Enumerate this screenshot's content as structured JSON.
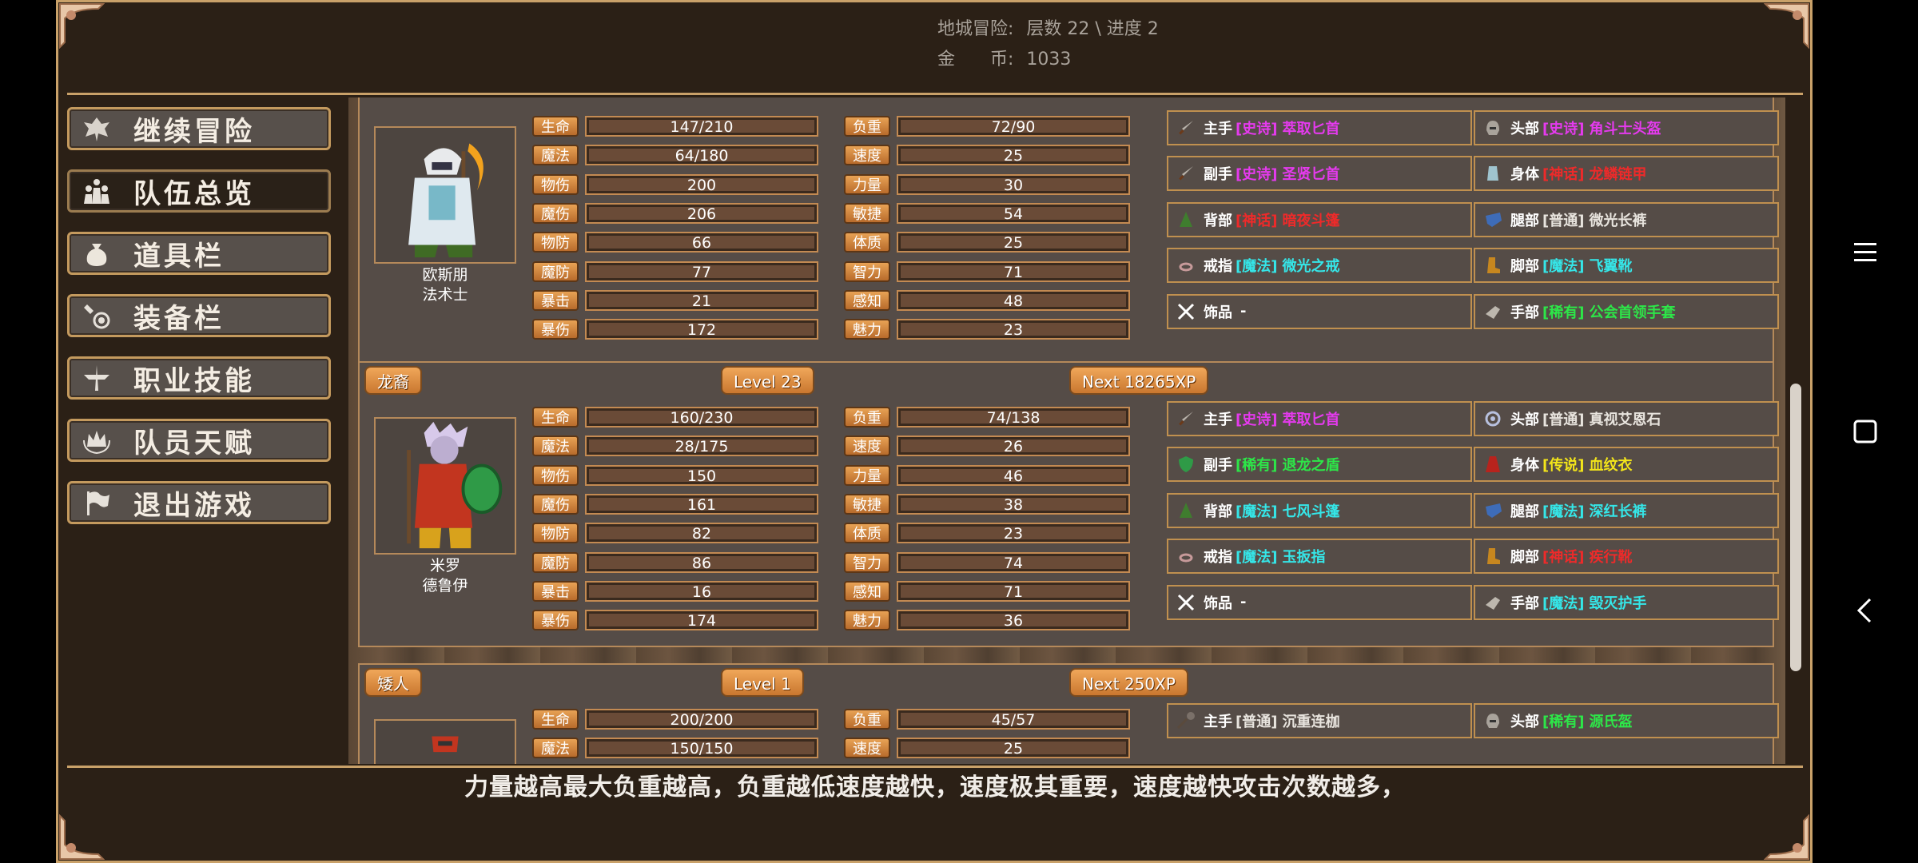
{
  "header": {
    "dungeon_label": "地城冒险:",
    "dungeon_value": "层数 22 \\ 进度 2",
    "gold_label": "金　　币:",
    "gold_value": "1033"
  },
  "menu": [
    {
      "label": "继续冒险",
      "icon": "dragon-icon",
      "active": false
    },
    {
      "label": "队伍总览",
      "icon": "party-icon",
      "active": true
    },
    {
      "label": "道具栏",
      "icon": "bag-icon",
      "active": false
    },
    {
      "label": "装备栏",
      "icon": "equipment-icon",
      "active": false
    },
    {
      "label": "职业技能",
      "icon": "skill-icon",
      "active": false
    },
    {
      "label": "队员天赋",
      "icon": "talent-icon",
      "active": false
    },
    {
      "label": "退出游戏",
      "icon": "flag-icon",
      "active": false
    }
  ],
  "stat_labels_left": [
    "生命",
    "魔法",
    "物伤",
    "魔伤",
    "物防",
    "魔防",
    "暴击",
    "暴伤"
  ],
  "stat_labels_right": [
    "负重",
    "速度",
    "力量",
    "敏捷",
    "体质",
    "智力",
    "感知",
    "魅力"
  ],
  "members": [
    {
      "race": "",
      "level": "",
      "next_xp": "",
      "name": "欧斯朋",
      "class": "法术士",
      "stats_left": [
        "147/210",
        "64/180",
        "200",
        "206",
        "66",
        "77",
        "21",
        "172"
      ],
      "stats_right": [
        "72/90",
        "25",
        "30",
        "54",
        "25",
        "71",
        "48",
        "23"
      ],
      "equipment": [
        {
          "slot": "主手",
          "rarity": "[史诗]",
          "item": "萃取匕首",
          "rarity_class": "r-epic",
          "icon": "dagger-icon"
        },
        {
          "slot": "头部",
          "rarity": "[史诗]",
          "item": "角斗士头盔",
          "rarity_class": "r-epic",
          "icon": "helmet-icon"
        },
        {
          "slot": "副手",
          "rarity": "[史诗]",
          "item": "圣贤匕首",
          "rarity_class": "r-epic",
          "icon": "dagger-icon"
        },
        {
          "slot": "身体",
          "rarity": "[神话]",
          "item": "龙鳞链甲",
          "rarity_class": "r-leg",
          "icon": "armor-icon"
        },
        {
          "slot": "背部",
          "rarity": "[神话]",
          "item": "暗夜斗篷",
          "rarity_class": "r-leg",
          "icon": "cloak-icon"
        },
        {
          "slot": "腿部",
          "rarity": "[普通]",
          "item": "微光长裤",
          "rarity_class": "r-common",
          "icon": "pants-icon"
        },
        {
          "slot": "戒指",
          "rarity": "[魔法]",
          "item": "微光之戒",
          "rarity_class": "r-magic",
          "icon": "ring-icon"
        },
        {
          "slot": "脚部",
          "rarity": "[魔法]",
          "item": "飞翼靴",
          "rarity_class": "r-magic",
          "icon": "boots-icon"
        },
        {
          "slot": "饰品",
          "rarity": "",
          "item": "-",
          "rarity_class": "r-none",
          "icon": "empty-slot-icon"
        },
        {
          "slot": "手部",
          "rarity": "[稀有]",
          "item": "公会首领手套",
          "rarity_class": "r-rare",
          "icon": "gloves-icon"
        }
      ]
    },
    {
      "race": "龙裔",
      "level": "Level 23",
      "next_xp": "Next 18265XP",
      "name": "米罗",
      "class": "德鲁伊",
      "stats_left": [
        "160/230",
        "28/175",
        "150",
        "161",
        "82",
        "86",
        "16",
        "174"
      ],
      "stats_right": [
        "74/138",
        "26",
        "46",
        "38",
        "23",
        "74",
        "71",
        "36"
      ],
      "equipment": [
        {
          "slot": "主手",
          "rarity": "[史诗]",
          "item": "萃取匕首",
          "rarity_class": "r-epic",
          "icon": "dagger-icon"
        },
        {
          "slot": "头部",
          "rarity": "[普通]",
          "item": "真视艾恩石",
          "rarity_class": "r-common",
          "icon": "stone-icon"
        },
        {
          "slot": "副手",
          "rarity": "[稀有]",
          "item": "退龙之盾",
          "rarity_class": "r-rare",
          "icon": "shield-icon"
        },
        {
          "slot": "身体",
          "rarity": "[传说]",
          "item": "血纹衣",
          "rarity_class": "r-legend",
          "icon": "robe-icon"
        },
        {
          "slot": "背部",
          "rarity": "[魔法]",
          "item": "七风斗篷",
          "rarity_class": "r-magic",
          "icon": "cloak-icon"
        },
        {
          "slot": "腿部",
          "rarity": "[魔法]",
          "item": "深红长裤",
          "rarity_class": "r-magic",
          "icon": "pants-icon"
        },
        {
          "slot": "戒指",
          "rarity": "[魔法]",
          "item": "玉扳指",
          "rarity_class": "r-magic",
          "icon": "ring-icon"
        },
        {
          "slot": "脚部",
          "rarity": "[神话]",
          "item": "疾行靴",
          "rarity_class": "r-leg",
          "icon": "boots-icon"
        },
        {
          "slot": "饰品",
          "rarity": "",
          "item": "-",
          "rarity_class": "r-none",
          "icon": "empty-slot-icon"
        },
        {
          "slot": "手部",
          "rarity": "[魔法]",
          "item": "毁灭护手",
          "rarity_class": "r-magic",
          "icon": "gloves-icon"
        }
      ]
    },
    {
      "race": "矮人",
      "level": "Level 1",
      "next_xp": "Next 250XP",
      "name": "",
      "class": "",
      "stats_left": [
        "200/200",
        "150/150"
      ],
      "stats_right": [
        "45/57",
        "25"
      ],
      "equipment": [
        {
          "slot": "主手",
          "rarity": "[普通]",
          "item": "沉重连枷",
          "rarity_class": "r-common",
          "icon": "flail-icon"
        },
        {
          "slot": "头部",
          "rarity": "[稀有]",
          "item": "源氏盔",
          "rarity_class": "r-rare",
          "icon": "helmet-icon"
        }
      ]
    }
  ],
  "tip": "力量越高最大负重越高，负重越低速度越快，速度极其重要，速度越快攻击次数越多，"
}
